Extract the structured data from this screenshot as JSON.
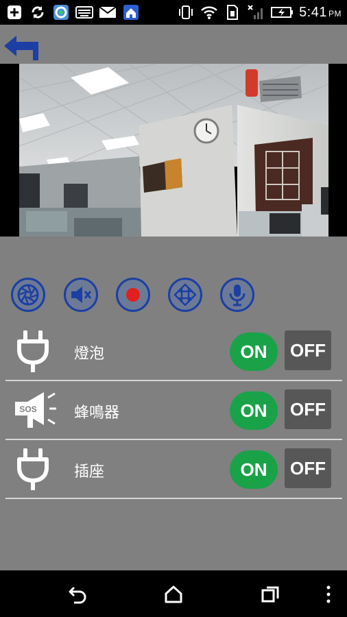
{
  "status_bar": {
    "time": "5:41",
    "ampm": "PM",
    "icons": [
      "add-icon",
      "sync-icon",
      "app-circle-icon",
      "keyboard-icon",
      "mail-icon",
      "home-app-icon",
      "vibrate-icon",
      "wifi-icon",
      "sim-icon",
      "no-signal-icon",
      "battery-charging-icon"
    ]
  },
  "header": {
    "back_icon": "back-arrow-icon"
  },
  "camera": {
    "description_icon": "camera-feed"
  },
  "controls": [
    {
      "name": "snapshot-button",
      "icon": "aperture-icon"
    },
    {
      "name": "mute-button",
      "icon": "speaker-mute-icon"
    },
    {
      "name": "record-button",
      "icon": "record-icon"
    },
    {
      "name": "ptz-button",
      "icon": "direction-pad-icon"
    },
    {
      "name": "microphone-button",
      "icon": "microphone-icon"
    }
  ],
  "devices": [
    {
      "label": "燈泡",
      "icon": "plug-icon",
      "on_label": "ON",
      "off_label": "OFF"
    },
    {
      "label": "蜂鳴器",
      "icon": "sos-megaphone-icon",
      "icon_text": "SOS",
      "on_label": "ON",
      "off_label": "OFF"
    },
    {
      "label": "插座",
      "icon": "plug-icon",
      "on_label": "ON",
      "off_label": "OFF"
    }
  ],
  "colors": {
    "app_background": "#808080",
    "accent_blue": "#1b3fa3",
    "on_green": "#1aa248",
    "off_gray": "#575757",
    "record_red": "#e0201f"
  },
  "nav_bar": {
    "icons": [
      "back-nav-icon",
      "home-nav-icon",
      "recents-nav-icon",
      "menu-dots-icon"
    ]
  }
}
